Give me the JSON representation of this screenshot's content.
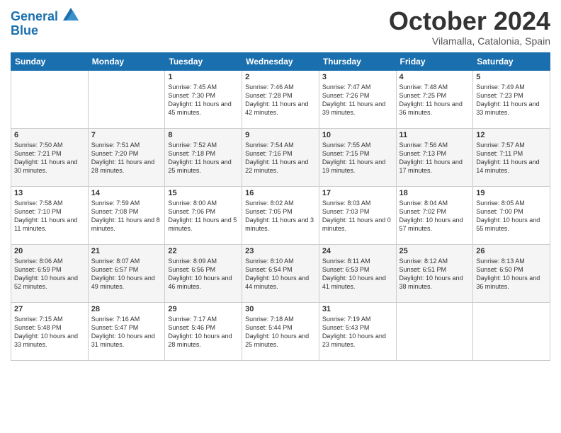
{
  "logo": {
    "line1": "General",
    "line2": "Blue"
  },
  "title": "October 2024",
  "subtitle": "Vilamalla, Catalonia, Spain",
  "days_of_week": [
    "Sunday",
    "Monday",
    "Tuesday",
    "Wednesday",
    "Thursday",
    "Friday",
    "Saturday"
  ],
  "weeks": [
    [
      {
        "day": "",
        "content": ""
      },
      {
        "day": "",
        "content": ""
      },
      {
        "day": "1",
        "content": "Sunrise: 7:45 AM\nSunset: 7:30 PM\nDaylight: 11 hours and 45 minutes."
      },
      {
        "day": "2",
        "content": "Sunrise: 7:46 AM\nSunset: 7:28 PM\nDaylight: 11 hours and 42 minutes."
      },
      {
        "day": "3",
        "content": "Sunrise: 7:47 AM\nSunset: 7:26 PM\nDaylight: 11 hours and 39 minutes."
      },
      {
        "day": "4",
        "content": "Sunrise: 7:48 AM\nSunset: 7:25 PM\nDaylight: 11 hours and 36 minutes."
      },
      {
        "day": "5",
        "content": "Sunrise: 7:49 AM\nSunset: 7:23 PM\nDaylight: 11 hours and 33 minutes."
      }
    ],
    [
      {
        "day": "6",
        "content": "Sunrise: 7:50 AM\nSunset: 7:21 PM\nDaylight: 11 hours and 30 minutes."
      },
      {
        "day": "7",
        "content": "Sunrise: 7:51 AM\nSunset: 7:20 PM\nDaylight: 11 hours and 28 minutes."
      },
      {
        "day": "8",
        "content": "Sunrise: 7:52 AM\nSunset: 7:18 PM\nDaylight: 11 hours and 25 minutes."
      },
      {
        "day": "9",
        "content": "Sunrise: 7:54 AM\nSunset: 7:16 PM\nDaylight: 11 hours and 22 minutes."
      },
      {
        "day": "10",
        "content": "Sunrise: 7:55 AM\nSunset: 7:15 PM\nDaylight: 11 hours and 19 minutes."
      },
      {
        "day": "11",
        "content": "Sunrise: 7:56 AM\nSunset: 7:13 PM\nDaylight: 11 hours and 17 minutes."
      },
      {
        "day": "12",
        "content": "Sunrise: 7:57 AM\nSunset: 7:11 PM\nDaylight: 11 hours and 14 minutes."
      }
    ],
    [
      {
        "day": "13",
        "content": "Sunrise: 7:58 AM\nSunset: 7:10 PM\nDaylight: 11 hours and 11 minutes."
      },
      {
        "day": "14",
        "content": "Sunrise: 7:59 AM\nSunset: 7:08 PM\nDaylight: 11 hours and 8 minutes."
      },
      {
        "day": "15",
        "content": "Sunrise: 8:00 AM\nSunset: 7:06 PM\nDaylight: 11 hours and 5 minutes."
      },
      {
        "day": "16",
        "content": "Sunrise: 8:02 AM\nSunset: 7:05 PM\nDaylight: 11 hours and 3 minutes."
      },
      {
        "day": "17",
        "content": "Sunrise: 8:03 AM\nSunset: 7:03 PM\nDaylight: 11 hours and 0 minutes."
      },
      {
        "day": "18",
        "content": "Sunrise: 8:04 AM\nSunset: 7:02 PM\nDaylight: 10 hours and 57 minutes."
      },
      {
        "day": "19",
        "content": "Sunrise: 8:05 AM\nSunset: 7:00 PM\nDaylight: 10 hours and 55 minutes."
      }
    ],
    [
      {
        "day": "20",
        "content": "Sunrise: 8:06 AM\nSunset: 6:59 PM\nDaylight: 10 hours and 52 minutes."
      },
      {
        "day": "21",
        "content": "Sunrise: 8:07 AM\nSunset: 6:57 PM\nDaylight: 10 hours and 49 minutes."
      },
      {
        "day": "22",
        "content": "Sunrise: 8:09 AM\nSunset: 6:56 PM\nDaylight: 10 hours and 46 minutes."
      },
      {
        "day": "23",
        "content": "Sunrise: 8:10 AM\nSunset: 6:54 PM\nDaylight: 10 hours and 44 minutes."
      },
      {
        "day": "24",
        "content": "Sunrise: 8:11 AM\nSunset: 6:53 PM\nDaylight: 10 hours and 41 minutes."
      },
      {
        "day": "25",
        "content": "Sunrise: 8:12 AM\nSunset: 6:51 PM\nDaylight: 10 hours and 38 minutes."
      },
      {
        "day": "26",
        "content": "Sunrise: 8:13 AM\nSunset: 6:50 PM\nDaylight: 10 hours and 36 minutes."
      }
    ],
    [
      {
        "day": "27",
        "content": "Sunrise: 7:15 AM\nSunset: 5:48 PM\nDaylight: 10 hours and 33 minutes."
      },
      {
        "day": "28",
        "content": "Sunrise: 7:16 AM\nSunset: 5:47 PM\nDaylight: 10 hours and 31 minutes."
      },
      {
        "day": "29",
        "content": "Sunrise: 7:17 AM\nSunset: 5:46 PM\nDaylight: 10 hours and 28 minutes."
      },
      {
        "day": "30",
        "content": "Sunrise: 7:18 AM\nSunset: 5:44 PM\nDaylight: 10 hours and 25 minutes."
      },
      {
        "day": "31",
        "content": "Sunrise: 7:19 AM\nSunset: 5:43 PM\nDaylight: 10 hours and 23 minutes."
      },
      {
        "day": "",
        "content": ""
      },
      {
        "day": "",
        "content": ""
      }
    ]
  ]
}
